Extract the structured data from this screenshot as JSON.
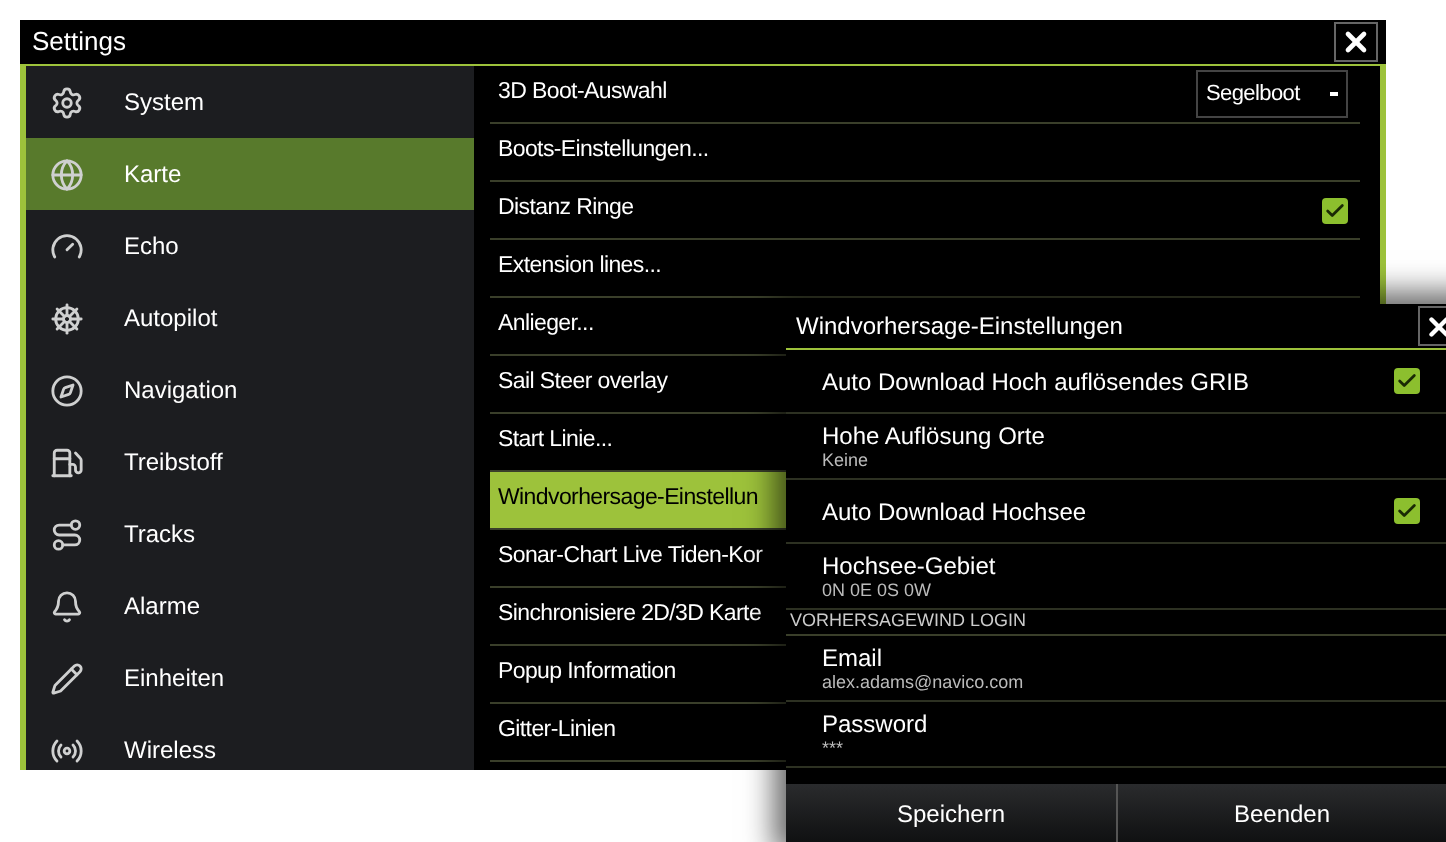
{
  "window": {
    "title": "Settings"
  },
  "sidebar": {
    "items": [
      {
        "label": "System",
        "selected": false
      },
      {
        "label": "Karte",
        "selected": true
      },
      {
        "label": "Echo",
        "selected": false
      },
      {
        "label": "Autopilot",
        "selected": false
      },
      {
        "label": "Navigation",
        "selected": false
      },
      {
        "label": "Treibstoff",
        "selected": false
      },
      {
        "label": "Tracks",
        "selected": false
      },
      {
        "label": "Alarme",
        "selected": false
      },
      {
        "label": "Einheiten",
        "selected": false
      },
      {
        "label": "Wireless",
        "selected": false
      }
    ]
  },
  "settings_list": [
    {
      "kind": "dropdown",
      "label": "3D Boot-Auswahl",
      "value": "Segelboot",
      "selected": false
    },
    {
      "kind": "link",
      "label": "Boots-Einstellungen...",
      "selected": false
    },
    {
      "kind": "checkbox",
      "label": "Distanz Ringe",
      "checked": true,
      "selected": false
    },
    {
      "kind": "link",
      "label": "Extension lines...",
      "selected": false
    },
    {
      "kind": "link",
      "label": "Anlieger...",
      "selected": false
    },
    {
      "kind": "link",
      "label": "Sail Steer overlay",
      "selected": false
    },
    {
      "kind": "link",
      "label": "Start Linie...",
      "selected": false
    },
    {
      "kind": "link",
      "label": "Windvorhersage-Einstellun",
      "selected": true
    },
    {
      "kind": "link",
      "label": "Sonar-Chart Live Tiden-Kor",
      "selected": false
    },
    {
      "kind": "link",
      "label": "Sinchronisiere 2D/3D Karte",
      "selected": false
    },
    {
      "kind": "link",
      "label": "Popup Information",
      "selected": false
    },
    {
      "kind": "link",
      "label": "Gitter-Linien",
      "selected": false
    }
  ],
  "dialog": {
    "title": "Windvorhersage-Einstellungen",
    "items": [
      {
        "kind": "checkbox",
        "label": "Auto Download Hoch auflösendes GRIB",
        "checked": true
      },
      {
        "kind": "value",
        "label": "Hohe Auflösung Orte",
        "value": "Keine"
      },
      {
        "kind": "checkbox",
        "label": "Auto Download Hochsee",
        "checked": true
      },
      {
        "kind": "value",
        "label": "Hochsee-Gebiet",
        "value": "0N 0E 0S 0W"
      },
      {
        "kind": "section",
        "label": "VORHERSAGEWIND LOGIN"
      },
      {
        "kind": "value",
        "label": "Email",
        "value": "alex.adams@navico.com"
      },
      {
        "kind": "value",
        "label": "Password",
        "value": "***"
      }
    ],
    "buttons": [
      "Speichern",
      "Beenden"
    ]
  }
}
